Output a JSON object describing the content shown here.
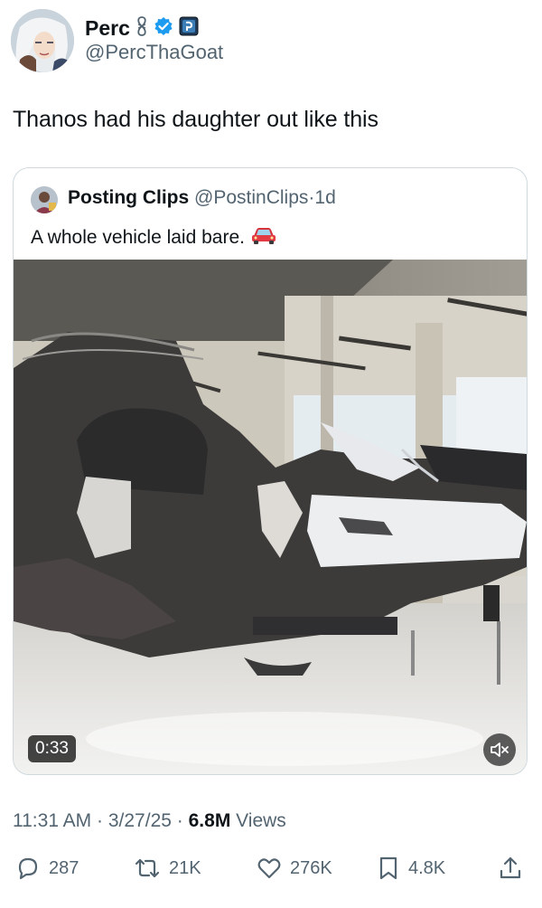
{
  "author": {
    "display_name": "Perc",
    "handle": "@PercThaGoat",
    "avatar_icon": "anime-avatar",
    "badges": [
      "infinity-icon",
      "verified-badge-icon",
      "affiliate-badge-icon"
    ]
  },
  "tweet": {
    "text": "Thanos had his daughter out like this"
  },
  "quoted": {
    "display_name": "Posting Clips",
    "handle": "@PostinClips",
    "separator": "·",
    "time": "1d",
    "text": "A whole vehicle laid bare.",
    "emoji_icon": "red-car-icon",
    "video": {
      "duration": "0:33",
      "mute_icon": "speaker-muted-icon"
    }
  },
  "meta": {
    "time": "11:31 AM",
    "separator": "·",
    "date": "3/27/25",
    "views_count": "6.8M",
    "views_label": "Views"
  },
  "actions": {
    "replies": "287",
    "reposts": "21K",
    "likes": "276K",
    "bookmarks": "4.8K",
    "icons": [
      "reply-icon",
      "repost-icon",
      "like-icon",
      "bookmark-icon",
      "share-icon"
    ]
  },
  "colors": {
    "text_primary": "#0f1419",
    "text_secondary": "#536471",
    "verified_blue": "#1d9bf0",
    "border": "#cfd9de"
  }
}
